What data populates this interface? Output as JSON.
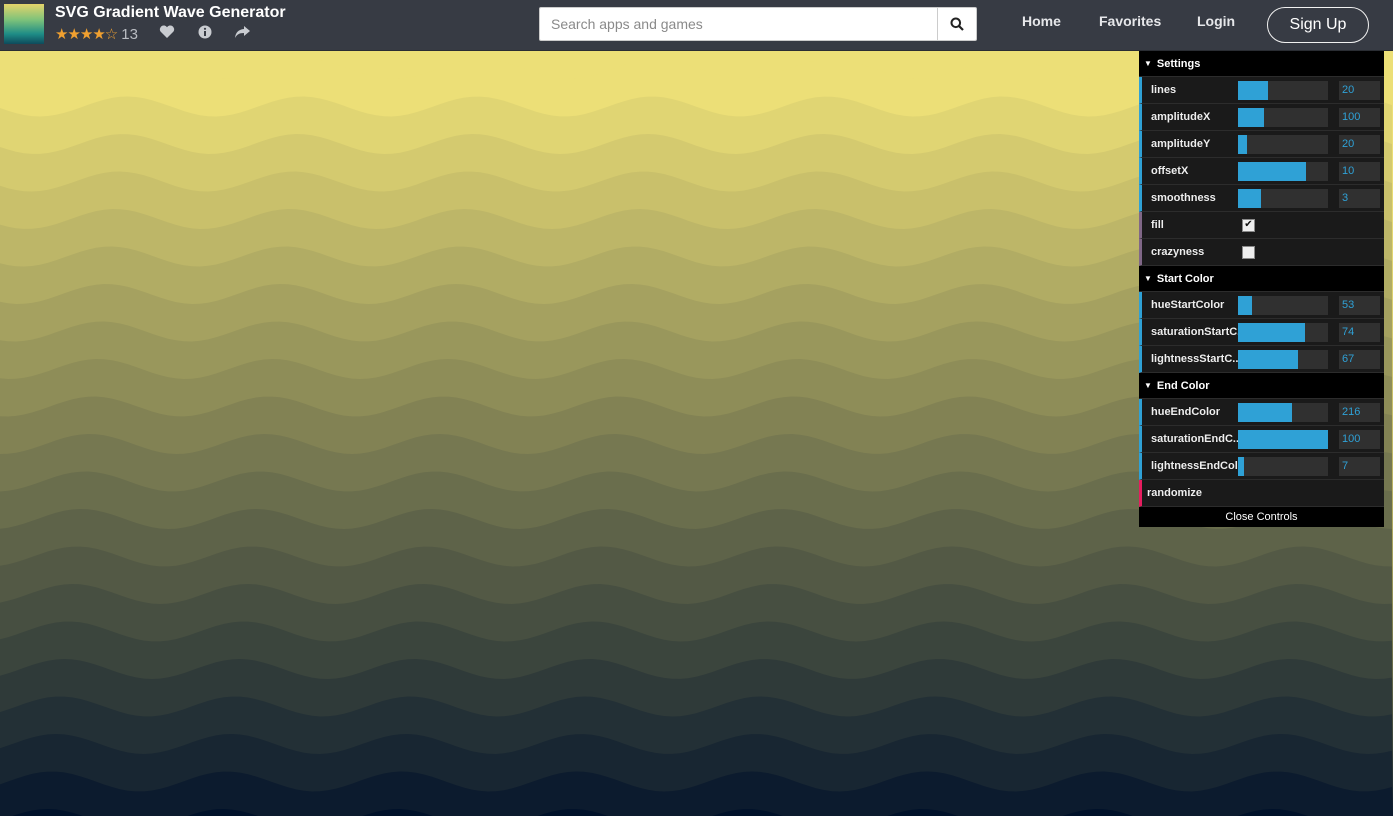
{
  "header": {
    "title": "SVG Gradient Wave Generator",
    "rating_stars": "★★★★☆",
    "rating_count": "13",
    "icons": [
      "heart-icon",
      "info-icon",
      "share-icon"
    ],
    "search_placeholder": "Search apps and games",
    "nav": {
      "home": "Home",
      "favorites": "Favorites",
      "login": "Login",
      "signup": "Sign Up"
    }
  },
  "canvas": {
    "lines": 20,
    "start_color": "#ecdf77",
    "end_color": "#00112a"
  },
  "controls": {
    "settings": {
      "title": "Settings",
      "lines": {
        "label": "lines",
        "value": "20",
        "fill": 0.33
      },
      "amplitudeX": {
        "label": "amplitudeX",
        "value": "100",
        "fill": 0.29
      },
      "amplitudeY": {
        "label": "amplitudeY",
        "value": "20",
        "fill": 0.1
      },
      "offsetX": {
        "label": "offsetX",
        "value": "10",
        "fill": 0.76
      },
      "smoothness": {
        "label": "smoothness",
        "value": "3",
        "fill": 0.25
      },
      "fill": {
        "label": "fill",
        "checked": "✔"
      },
      "crazyness": {
        "label": "crazyness",
        "checked": ""
      }
    },
    "start_color": {
      "title": "Start Color",
      "hue": {
        "label": "hueStartColor",
        "value": "53",
        "fill": 0.15
      },
      "saturation": {
        "label": "saturationStartC...",
        "value": "74",
        "fill": 0.74
      },
      "lightness": {
        "label": "lightnessStartC...",
        "value": "67",
        "fill": 0.67
      }
    },
    "end_color": {
      "title": "End Color",
      "hue": {
        "label": "hueEndColor",
        "value": "216",
        "fill": 0.6
      },
      "saturation": {
        "label": "saturationEndC...",
        "value": "100",
        "fill": 1.0
      },
      "lightness": {
        "label": "lightnessEndColor",
        "value": "7",
        "fill": 0.07
      }
    },
    "randomize": "randomize",
    "close": "Close Controls"
  }
}
